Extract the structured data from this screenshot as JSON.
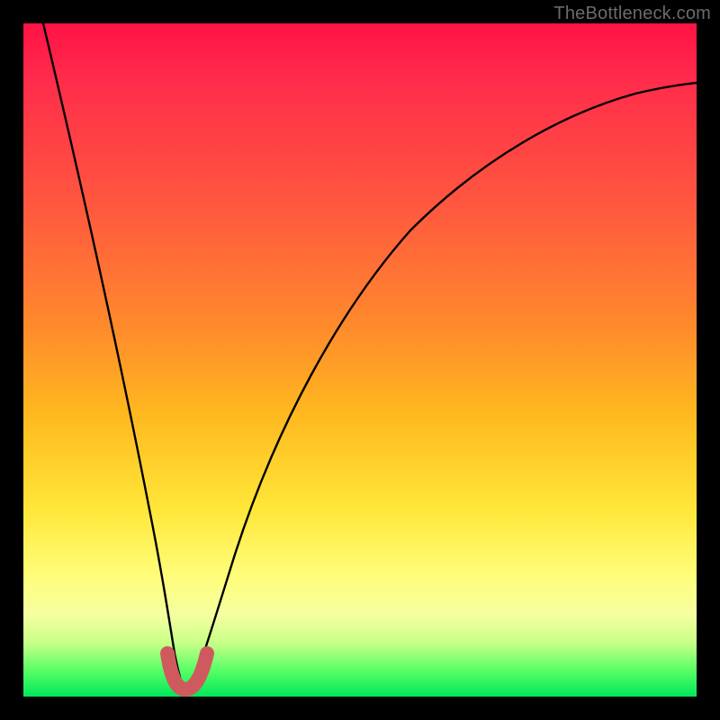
{
  "watermark": {
    "text": "TheBottleneck.com"
  },
  "chart_data": {
    "type": "line",
    "title": "",
    "xlabel": "",
    "ylabel": "",
    "xlim": [
      0,
      100
    ],
    "ylim": [
      0,
      100
    ],
    "grid": false,
    "legend": false,
    "annotations": [],
    "series": [
      {
        "name": "bottleneck-curve",
        "color": "#000000",
        "x": [
          3,
          6,
          9,
          12,
          15,
          17,
          19,
          21,
          22,
          23,
          24,
          25,
          27,
          30,
          34,
          38,
          44,
          50,
          58,
          66,
          74,
          82,
          90,
          100
        ],
        "values": [
          100,
          86,
          72,
          58,
          44,
          32,
          22,
          12,
          6,
          2,
          2,
          6,
          14,
          26,
          40,
          50,
          60,
          68,
          75,
          80,
          84,
          87,
          89,
          91
        ]
      },
      {
        "name": "optimal-band",
        "color": "#cf5a5e",
        "x": [
          21,
          22,
          23,
          24,
          25
        ],
        "values": [
          5,
          1,
          0,
          1,
          5
        ]
      }
    ],
    "background_gradient": {
      "stops": [
        {
          "pos": 0,
          "color": "#ff1246"
        },
        {
          "pos": 28,
          "color": "#ff5a3e"
        },
        {
          "pos": 58,
          "color": "#ffb81f"
        },
        {
          "pos": 82,
          "color": "#fffd7a"
        },
        {
          "pos": 100,
          "color": "#00e85a"
        }
      ]
    }
  }
}
